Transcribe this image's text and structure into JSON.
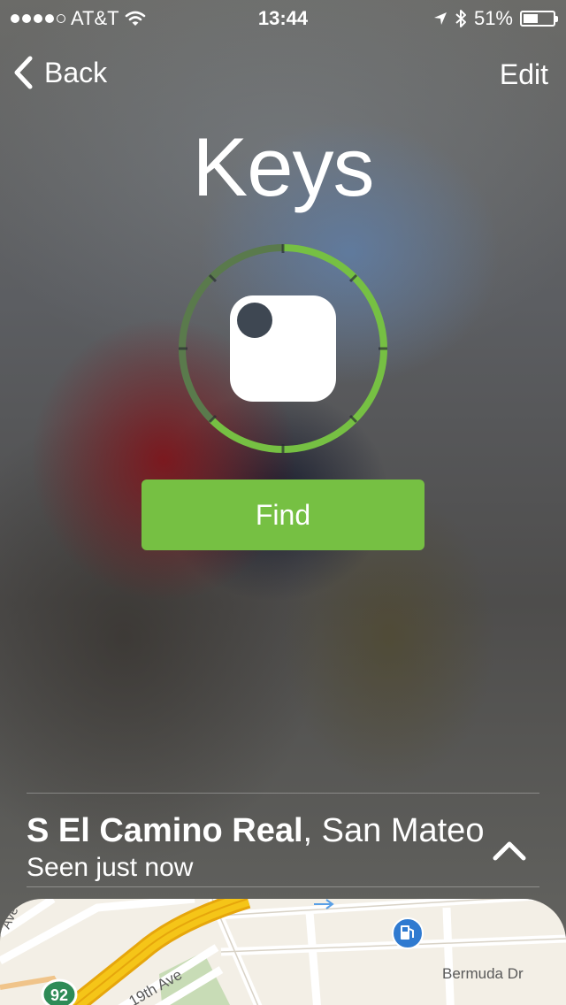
{
  "status_bar": {
    "signal_bars_filled": 4,
    "signal_bars_total": 5,
    "carrier": "AT&T",
    "time": "13:44",
    "battery_percent": "51%",
    "battery_level": 0.51
  },
  "nav": {
    "back_label": "Back",
    "edit_label": "Edit"
  },
  "device": {
    "name": "Keys",
    "find_label": "Find"
  },
  "location": {
    "street": "S El Camino Real",
    "separator": ",",
    "city": " San Mateo",
    "seen_text": "Seen just now"
  },
  "map": {
    "highway_shield": "92",
    "street_19th": "19th Ave",
    "street_bermuda": "Bermuda Dr",
    "street_ave_partial": "Ave"
  },
  "colors": {
    "accent_green": "#76c043",
    "ring_dim_green": "#5a7a4c",
    "map_land": "#f3efe6",
    "map_highway": "#f5c518",
    "map_park": "#c8dcb6",
    "gas_blue": "#2f7ad0"
  },
  "icons": {
    "wifi": "wifi-icon",
    "location_arrow": "location-arrow-icon",
    "bluetooth": "bluetooth-icon",
    "battery": "battery-icon",
    "back_chevron": "chevron-left-icon",
    "tile": "tile-device-icon",
    "expand": "chevron-up-icon",
    "gas_station": "gas-station-icon"
  }
}
